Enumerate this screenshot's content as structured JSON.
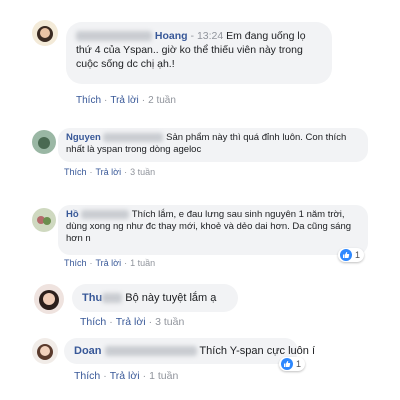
{
  "comments": [
    {
      "name": "Hoang",
      "time": "13:24",
      "text": "Em đang uống lọ thứ 4 của Yspan.. giờ ko thể thiếu viên này trong cuộc sống dc chị ạh.!",
      "like": "Thích",
      "reply": "Trả lời",
      "ago": "2 tuần"
    },
    {
      "name": "Nguyen",
      "text": "Sản phẩm này thì quá đỉnh luôn. Con thích nhất là yspan trong dòng ageloc",
      "like": "Thích",
      "reply": "Trả lời",
      "ago": "3 tuần"
    },
    {
      "name": "Hồ",
      "text": "Thích lắm, e đau lưng sau sinh nguyên 1 năm trời, dùng xong ng như đc thay mới, khoẻ và dẻo dai hơn. Da cũng sáng hơn n",
      "like": "Thích",
      "reply": "Trả lời",
      "ago": "1 tuần",
      "reactions": "1"
    },
    {
      "name": "Thu",
      "text": "Bộ này tuyệt lắm ạ",
      "like": "Thích",
      "reply": "Trả lời",
      "ago": "3 tuần"
    },
    {
      "name": "Doan",
      "text": "Thích Y-span cực luôn í",
      "like": "Thích",
      "reply": "Trả lời",
      "ago": "1 tuần",
      "reactions": "1"
    }
  ],
  "colors": {
    "link": "#385898",
    "bubble": "#f2f3f5",
    "like_badge": "#2d88ff"
  },
  "icons": {
    "reaction": "like-icon"
  }
}
